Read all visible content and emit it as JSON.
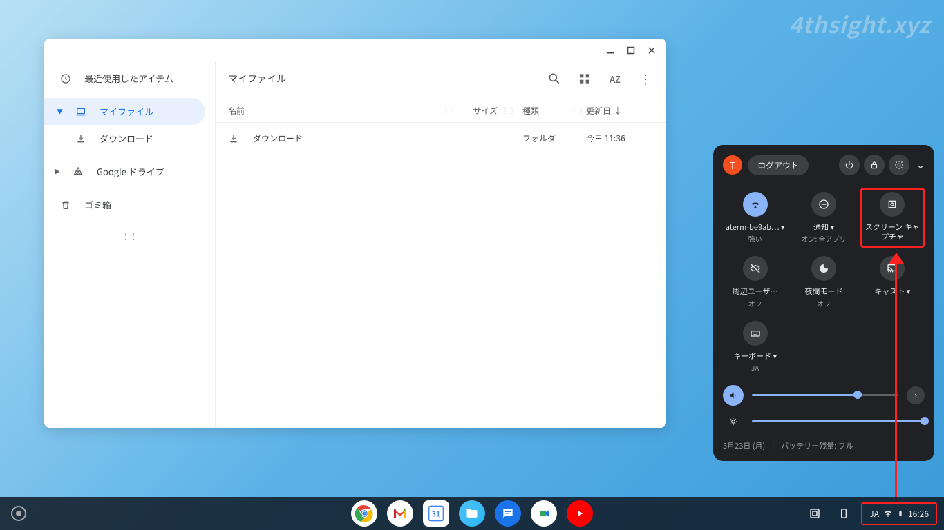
{
  "watermark": "4thsight.xyz",
  "sidebar": {
    "recent": "最近使用したアイテム",
    "myfiles": "マイファイル",
    "downloads": "ダウンロード",
    "gdrive": "Google ドライブ",
    "trash": "ゴミ箱"
  },
  "main": {
    "title": "マイファイル",
    "columns": {
      "name": "名前",
      "size": "サイズ",
      "type": "種類",
      "date": "更新日"
    },
    "rows": [
      {
        "name": "ダウンロード",
        "size": "–",
        "type": "フォルダ",
        "date": "今日 11:36"
      }
    ]
  },
  "qs": {
    "avatar": "T",
    "logout": "ログアウト",
    "tiles": {
      "wifi": {
        "label": "aterm-be9ab…",
        "sub": "強い"
      },
      "notif": {
        "label": "通知",
        "sub": "オン: 全アプリ"
      },
      "capture": {
        "label": "スクリーン キャプチャ"
      },
      "nearby": {
        "label": "周辺ユーザ…",
        "sub": "オフ"
      },
      "night": {
        "label": "夜間モード",
        "sub": "オフ"
      },
      "cast": {
        "label": "キャスト"
      },
      "keyboard": {
        "label": "キーボード",
        "sub": "JA"
      }
    },
    "date": "5月23日 (月)",
    "battery": "バッテリー残量: フル"
  },
  "shelf": {
    "ime": "JA",
    "time": "16:26"
  }
}
